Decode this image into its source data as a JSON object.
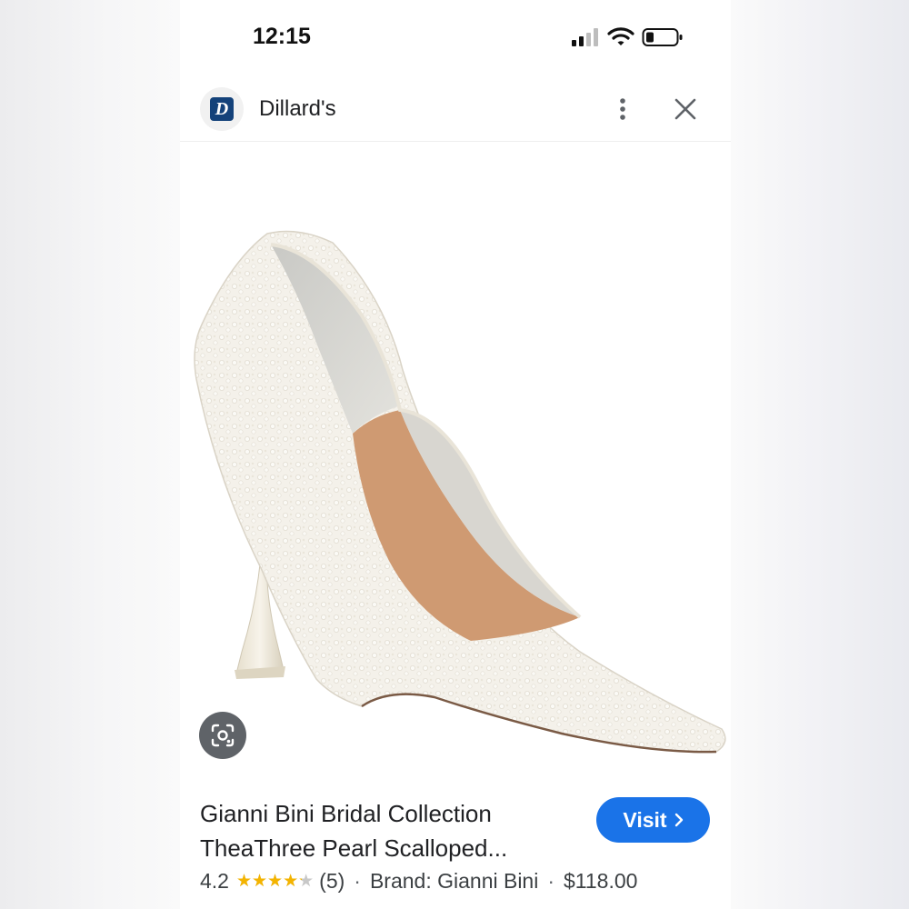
{
  "status_bar": {
    "time": "12:15",
    "icons": [
      "cellular-signal-icon",
      "wifi-icon",
      "battery-icon"
    ]
  },
  "header": {
    "site_name": "Dillard's",
    "logo_letter": "D",
    "logo_color": "#14427a",
    "more_icon": "vertical-dots-icon",
    "close_icon": "close-icon"
  },
  "image": {
    "description_icon": "google-lens-icon"
  },
  "product": {
    "title_line1": "Gianni Bini Bridal Collection",
    "title_line2": "TheaThree Pearl Scalloped...",
    "rating": "4.2",
    "rating_value": 4.2,
    "rating_max": 5,
    "review_count": "(5)",
    "brand": "Brand: Gianni Bini",
    "price": "$118.00",
    "separator": "·"
  },
  "actions": {
    "visit_label": "Visit",
    "visit_icon": "chevron-right-icon"
  },
  "colors": {
    "accent": "#1a73e8",
    "star": "#f4b400"
  }
}
